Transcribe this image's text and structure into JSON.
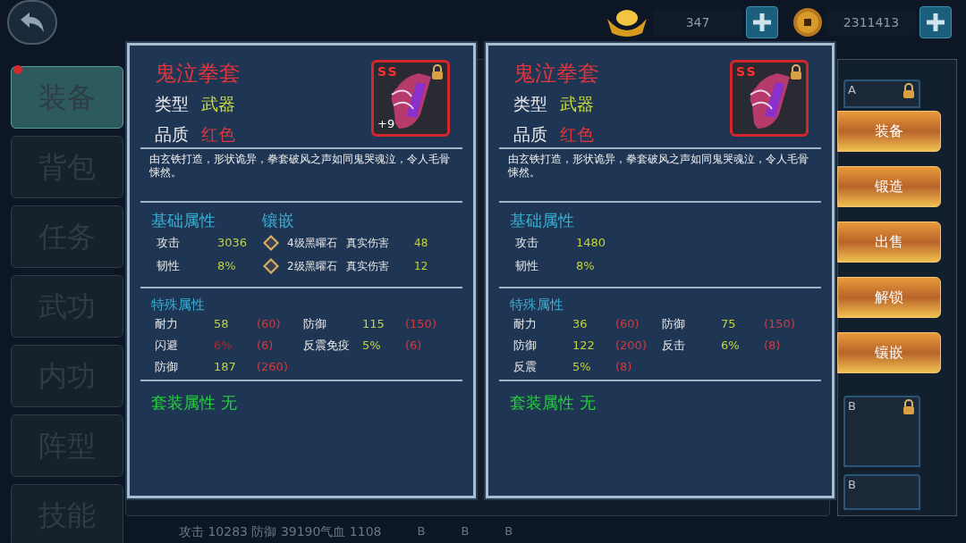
{
  "currencies": [
    {
      "kind": "ingot",
      "amount": "347"
    },
    {
      "kind": "coin",
      "amount": "2311413"
    }
  ],
  "sidebar": {
    "items": [
      {
        "label": "装备",
        "selected": true,
        "notice": true
      },
      {
        "label": "背包",
        "selected": false,
        "notice": false
      },
      {
        "label": "任务",
        "selected": false,
        "notice": false
      },
      {
        "label": "武功",
        "selected": false,
        "notice": false
      },
      {
        "label": "内功",
        "selected": false,
        "notice": false
      },
      {
        "label": "阵型",
        "selected": false,
        "notice": false
      },
      {
        "label": "技能",
        "selected": false,
        "notice": false
      }
    ]
  },
  "summary_line": "攻击 10283 防御 39190气血 1108",
  "inventory": {
    "slots": [
      {
        "grade": "A",
        "locked": true
      },
      {
        "grade": "B",
        "locked": true
      },
      {
        "grade": "B",
        "locked": false
      }
    ],
    "bottom_row": [
      {
        "grade": "B"
      },
      {
        "grade": "B"
      },
      {
        "grade": "B"
      }
    ]
  },
  "cards": [
    {
      "name": "鬼泣拳套",
      "type_label": "类型",
      "type_value": "武器",
      "quality_label": "品质",
      "quality_value": "红色",
      "icon": {
        "grade": "SS",
        "locked": true,
        "enhance": "+9"
      },
      "description": "由玄铁打造，形状诡异，拳套破风之声如同鬼哭魂泣，令人毛骨悚然。",
      "base_title": "基础属性",
      "base_stats": [
        {
          "label": "攻击",
          "value": "3036"
        },
        {
          "label": "韧性",
          "value": "8%"
        }
      ],
      "inlay_title": "镶嵌",
      "gems": [
        {
          "name": "4级黑曜石",
          "effect": "真实伤害",
          "value": "48"
        },
        {
          "name": "2级黑曜石",
          "effect": "真实伤害",
          "value": "12"
        }
      ],
      "special_title": "特殊属性",
      "special_stats": [
        {
          "label": "耐力",
          "value": "58",
          "max": "(60)",
          "low": false
        },
        {
          "label": "防御",
          "value": "115",
          "max": "(150)",
          "low": false
        },
        {
          "label": "闪避",
          "value": "6%",
          "max": "(6)",
          "low": true
        },
        {
          "label": "反震免疫",
          "value": "5%",
          "max": "(6)",
          "low": false
        },
        {
          "label": "防御",
          "value": "187",
          "max": "(260)",
          "low": false
        }
      ],
      "set_text": "套装属性 无"
    },
    {
      "name": "鬼泣拳套",
      "type_label": "类型",
      "type_value": "武器",
      "quality_label": "品质",
      "quality_value": "红色",
      "icon": {
        "grade": "SS",
        "locked": true
      },
      "description": "由玄铁打造，形状诡异，拳套破风之声如同鬼哭魂泣，令人毛骨悚然。",
      "base_title": "基础属性",
      "base_stats": [
        {
          "label": "攻击",
          "value": "1480"
        },
        {
          "label": "韧性",
          "value": "8%"
        }
      ],
      "special_title": "特殊属性",
      "special_stats": [
        {
          "label": "耐力",
          "value": "36",
          "max": "(60)",
          "low": false
        },
        {
          "label": "防御",
          "value": "75",
          "max": "(150)",
          "low": false
        },
        {
          "label": "防御",
          "value": "122",
          "max": "(200)",
          "low": false
        },
        {
          "label": "反击",
          "value": "6%",
          "max": "(8)",
          "low": false
        },
        {
          "label": "反震",
          "value": "5%",
          "max": "(8)",
          "low": false
        }
      ],
      "set_text": "套装属性 无"
    }
  ],
  "actions": [
    "装备",
    "锻造",
    "出售",
    "解锁",
    "镶嵌"
  ]
}
